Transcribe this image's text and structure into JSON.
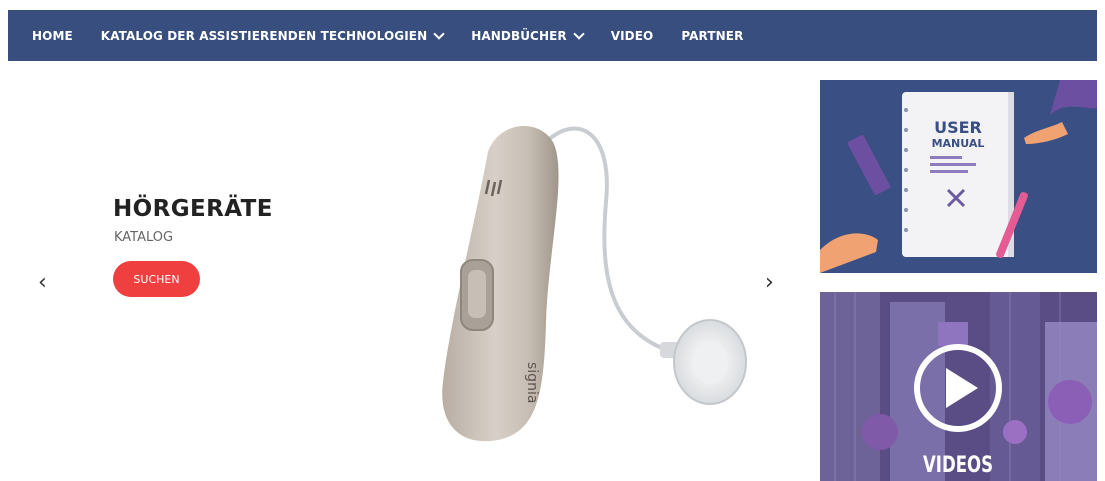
{
  "nav": {
    "items": [
      {
        "label": "HOME",
        "dropdown": false
      },
      {
        "label": "KATALOG DER ASSISTIERENDEN TECHNOLOGIEN",
        "dropdown": true
      },
      {
        "label": "HANDBÜCHER",
        "dropdown": true
      },
      {
        "label": "VIDEO",
        "dropdown": false
      },
      {
        "label": "PARTNER",
        "dropdown": false
      }
    ]
  },
  "slider": {
    "title": "HÖRGERÄTE",
    "subtitle": "KATALOG",
    "button_label": "SUCHEN",
    "prev_arrow": "‹",
    "next_arrow": "›",
    "product_brand": "signia"
  },
  "cards": {
    "manual": {
      "line1": "USER",
      "line2": "MANUAL"
    },
    "video": {
      "label": "VIDEOS"
    }
  },
  "colors": {
    "nav_bg": "#374e7e",
    "button_red": "#ef3f3f",
    "manual_bg": "#3a4f84",
    "video_bg": "#6a5a94"
  }
}
